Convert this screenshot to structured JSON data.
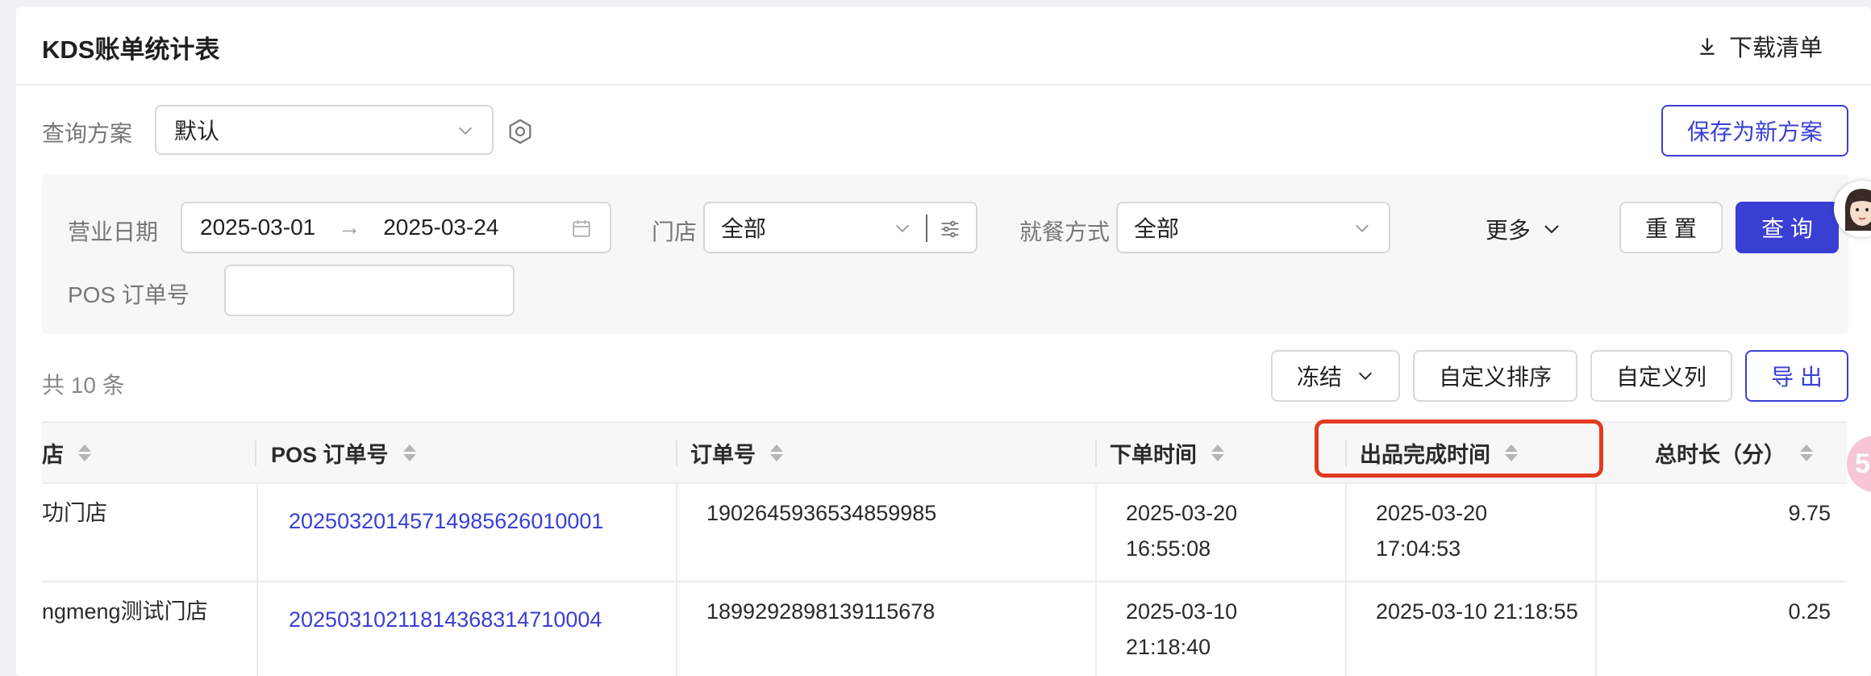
{
  "header": {
    "title": "KDS账单统计表",
    "download_label": "下载清单"
  },
  "scheme": {
    "label": "查询方案",
    "value": "默认",
    "save_label": "保存为新方案"
  },
  "filters": {
    "date_label": "营业日期",
    "date_start": "2025-03-01",
    "date_end": "2025-03-24",
    "store_label": "门店",
    "store_value": "全部",
    "dining_label": "就餐方式",
    "dining_value": "全部",
    "more_label": "更多",
    "reset_label": "重 置",
    "query_label": "查 询",
    "pos_label": "POS 订单号",
    "pos_value": ""
  },
  "toolbar": {
    "count": "共 10 条",
    "freeze_label": "冻结",
    "sort_label": "自定义排序",
    "columns_label": "自定义列",
    "export_label": "导 出"
  },
  "table": {
    "columns": [
      "店",
      "POS 订单号",
      "订单号",
      "下单时间",
      "出品完成时间",
      "总时长（分）"
    ],
    "rows": [
      {
        "store": "功门店",
        "pos": "202503201457149856260100​01",
        "order": "1902645936534859985",
        "order_time_1": "2025-03-20",
        "order_time_2": "16:55:08",
        "finish_1": "2025-03-20",
        "finish_2": "17:04:53",
        "duration": "9.75"
      },
      {
        "store": "ngmeng测试门店",
        "pos": "20250310211814368314710004",
        "order": "1899292898139115678",
        "order_time_1": "2025-03-10",
        "order_time_2": "21:18:40",
        "finish_1": "2025-03-10 21:18:55",
        "finish_2": "",
        "duration": "0.25"
      }
    ]
  },
  "badge": {
    "text": "5"
  },
  "colors": {
    "accent": "#3a3fd4",
    "highlight": "#e23b1f"
  }
}
